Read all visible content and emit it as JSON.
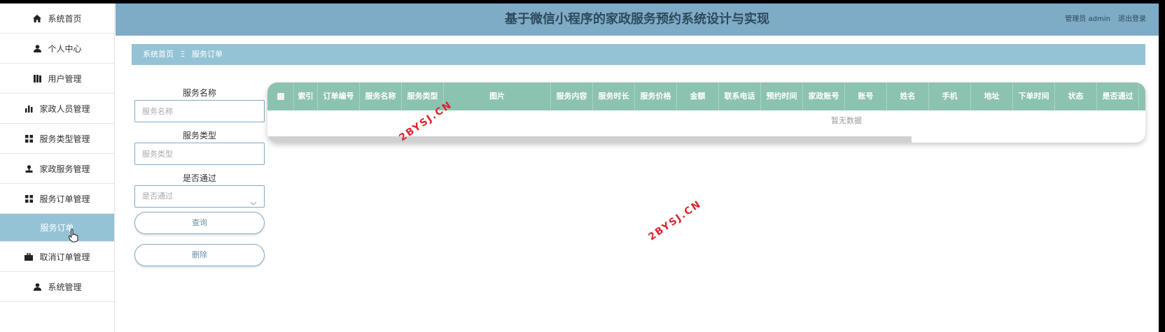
{
  "app": {
    "title": "基于微信小程序的家政服务预约系统设计与实现",
    "user_label": "管理员 admin",
    "logout": "退出登录"
  },
  "sidebar": {
    "items": [
      {
        "label": "系统首页",
        "icon": "home-icon"
      },
      {
        "label": "个人中心",
        "icon": "user-icon"
      },
      {
        "label": "用户管理",
        "icon": "book-icon"
      },
      {
        "label": "家政人员管理",
        "icon": "bar-chart-icon"
      },
      {
        "label": "服务类型管理",
        "icon": "grid-icon"
      },
      {
        "label": "家政服务管理",
        "icon": "stamp-icon"
      },
      {
        "label": "服务订单管理",
        "icon": "grid-icon"
      },
      {
        "label": "服务订单",
        "icon": "",
        "active": true
      },
      {
        "label": "取消订单管理",
        "icon": "briefcase-icon"
      },
      {
        "label": "系统管理",
        "icon": "user-icon"
      }
    ]
  },
  "breadcrumb": {
    "home": "系统首页",
    "separator": "Ξ",
    "current": "服务订单"
  },
  "search": {
    "name_label": "服务名称",
    "name_placeholder": "服务名称",
    "type_label": "服务类型",
    "type_placeholder": "服务类型",
    "pass_label": "是否通过",
    "pass_placeholder": "是否通过",
    "query_button": "查询",
    "delete_button": "删除"
  },
  "table": {
    "columns": [
      "索引",
      "订单编号",
      "服务名称",
      "服务类型",
      "图片",
      "服务内容",
      "服务时长",
      "服务价格",
      "金额",
      "联系电话",
      "预约时间",
      "家政账号",
      "账号",
      "姓名",
      "手机",
      "地址",
      "下单时间",
      "状态",
      "是否通过"
    ],
    "empty_text": "暂无数据"
  },
  "watermark": "2BYSJ.CN",
  "colors": {
    "header": "#7eabc6",
    "breadcrumb": "#94c3d5",
    "table_header": "#8cc2b0",
    "watermark": "#d9262c"
  }
}
